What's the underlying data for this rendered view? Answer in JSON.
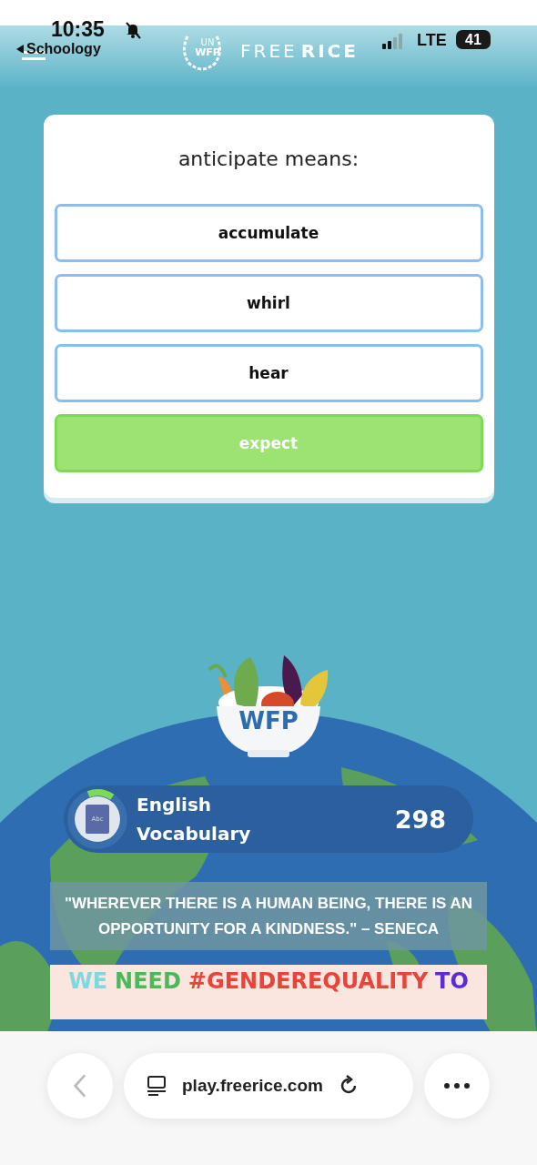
{
  "status_bar": {
    "time": "10:35",
    "back_app": "Schoology",
    "network": "LTE",
    "battery": "41"
  },
  "header": {
    "logo_un": "UN",
    "logo_wfp": "WFP",
    "brand_first": "FREE",
    "brand_second": "RICE"
  },
  "question": {
    "prompt": "anticipate means:",
    "options": [
      {
        "label": "accumulate",
        "selected": false
      },
      {
        "label": "whirl",
        "selected": false
      },
      {
        "label": "hear",
        "selected": false
      },
      {
        "label": "expect",
        "selected": true
      }
    ]
  },
  "bowl": {
    "label": "WFP"
  },
  "category": {
    "icon_text": "Abc",
    "title": "English Vocabulary",
    "score": "298",
    "level": 0.15
  },
  "quote": {
    "text": "\"WHEREVER THERE IS A HUMAN BEING, THERE IS AN OPPORTUNITY FOR A KINDNESS.\" – SENECA"
  },
  "banner": {
    "words": [
      {
        "text": "WE",
        "color": "#7fd8e0"
      },
      {
        "text": "NEED",
        "color": "#4cb85a"
      },
      {
        "text": "#GENDEREQUALITY",
        "color": "#e8443a"
      },
      {
        "text": "TO",
        "color": "#5b2bd6"
      }
    ]
  },
  "browser": {
    "url": "play.freerice.com"
  }
}
